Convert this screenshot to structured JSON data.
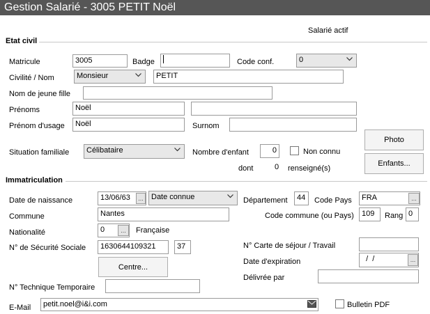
{
  "window": {
    "title": "Gestion Salarié - 3005 PETIT Noël"
  },
  "status": "Salarié actif",
  "etat_civil": {
    "section_title": "Etat civil",
    "matricule": {
      "label": "Matricule",
      "value": "3005"
    },
    "badge": {
      "label": "Badge",
      "value": ""
    },
    "code_conf": {
      "label": "Code conf.",
      "value": "0"
    },
    "civilite": {
      "label": "Civilité /  Nom",
      "value": "Monsieur"
    },
    "nom": {
      "value": "PETIT"
    },
    "nom_jeune_fille": {
      "label": "Nom de jeune fille",
      "value": ""
    },
    "prenoms": {
      "label": "Prénoms",
      "value": "Noël",
      "value2": ""
    },
    "prenom_usage": {
      "label": "Prénom d'usage",
      "value": "Noël"
    },
    "surnom": {
      "label": "Surnom",
      "value": ""
    },
    "situation": {
      "label": "Situation familiale",
      "value": "Célibataire"
    },
    "nombre_enfant": {
      "label": "Nombre d'enfant",
      "value": "0"
    },
    "non_connu": {
      "label": "Non connu",
      "checked": false
    },
    "dont": {
      "label": "dont",
      "value": "0",
      "suffix": "renseigné(s)"
    },
    "photo_button": "Photo",
    "enfants_button": "Enfants..."
  },
  "immatriculation": {
    "section_title": "Immatriculation",
    "date_naissance": {
      "label": "Date de naissance",
      "value": "13/06/63",
      "precision": "Date connue"
    },
    "departement": {
      "label": "Département",
      "value": "44"
    },
    "code_pays": {
      "label": "Code Pays",
      "value": "FRA"
    },
    "commune": {
      "label": "Commune",
      "value": "Nantes"
    },
    "code_commune": {
      "label": "Code commune (ou Pays)",
      "value": "109"
    },
    "rang": {
      "label": "Rang",
      "value": "0"
    },
    "nationalite": {
      "label": "Nationalité",
      "value": "0",
      "name": "Française"
    },
    "securite_sociale": {
      "label": "N° de Sécurité Sociale",
      "value": "1630644109321",
      "cle": "37"
    },
    "centre_button": "Centre...",
    "carte_sejour": {
      "label": "N° Carte de séjour / Travail",
      "value": ""
    },
    "date_expiration": {
      "label": "Date d'expiration",
      "value": "  /  /"
    },
    "delivree_par": {
      "label": "Délivrée par",
      "value": ""
    },
    "technique_temporaire": {
      "label": "N° Technique Temporaire",
      "value": ""
    },
    "email": {
      "label": "E-Mail",
      "value": "petit.noel@i&i.com"
    },
    "bulletin_pdf": {
      "label": "Bulletin PDF",
      "checked": false
    }
  },
  "mini_button_glyph": "...",
  "icons": {
    "dropdown": "chevron-down-icon",
    "mail": "envelope-icon"
  },
  "colors": {
    "titlebar": "#565656",
    "field_border": "#9a9a9a",
    "button_bg": "#f4f4f4"
  }
}
